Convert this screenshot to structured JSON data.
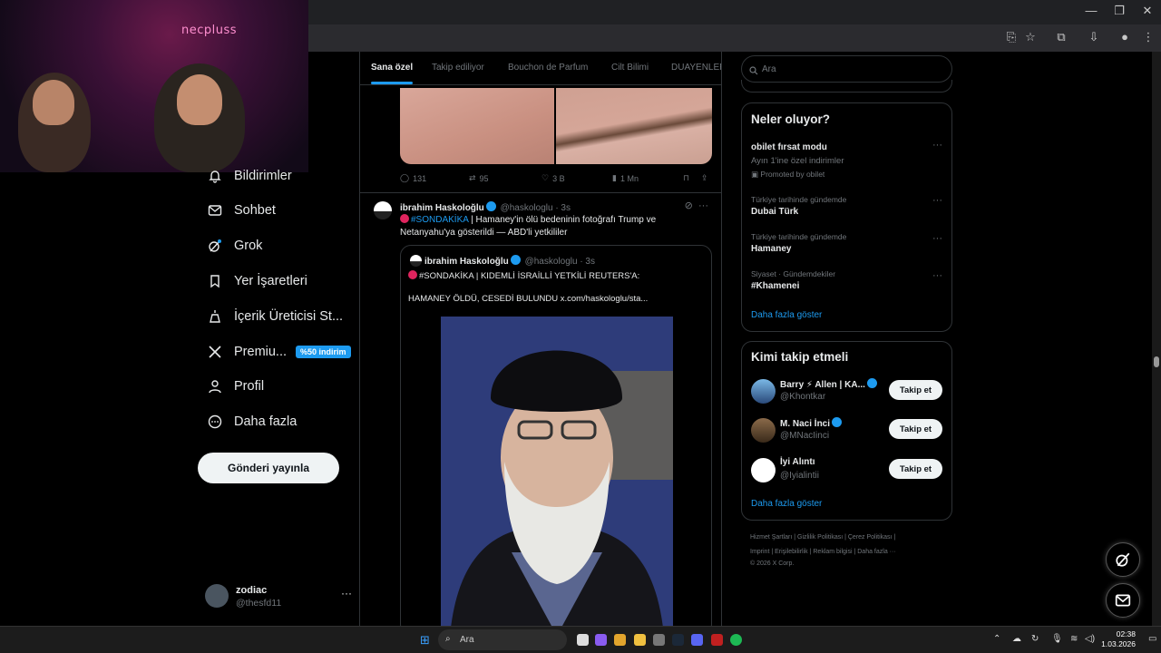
{
  "browser": {
    "minimize": "—",
    "restore": "❐",
    "close": "✕"
  },
  "webcam": {
    "brand": "necpluss"
  },
  "nav": {
    "items": [
      {
        "label": "Bildirimler",
        "icon": "bell-icon"
      },
      {
        "label": "Sohbet",
        "icon": "mail-icon"
      },
      {
        "label": "Grok",
        "icon": "grok-icon"
      },
      {
        "label": "Yer İşaretleri",
        "icon": "bookmark-icon"
      },
      {
        "label": "İçerik Üreticisi St...",
        "icon": "creator-icon"
      },
      {
        "label": "Premiu...",
        "icon": "x-logo-icon",
        "badge": "%50 indirim"
      },
      {
        "label": "Profil",
        "icon": "person-icon"
      },
      {
        "label": "Daha fazla",
        "icon": "more-circle-icon"
      }
    ],
    "post_button": "Gönderi yayınla",
    "account": {
      "name": "zodiac",
      "handle": "@thesfd11",
      "more": "···"
    }
  },
  "feed": {
    "tabs": [
      "Sana özel",
      "Takip ediliyor",
      "Bouchon de Parfum",
      "Cilt Bilimi",
      "DUAYENLER"
    ],
    "active_tab": "Sana özel",
    "prev_post_actions": {
      "replies": "131",
      "reposts": "95",
      "likes": "3 B",
      "views": "1 Mn"
    },
    "tweet": {
      "name": "ibrahim Haskoloğlu",
      "handle": "@haskologlu",
      "time": "· 3s",
      "hashtag": "#SONDAKİKA",
      "text": " | Hamaney'in ölü bedeninin fotoğrafı Trump ve Netanyahu'ya gösterildi — ABD'li yetkililer",
      "quote": {
        "name": "ibrahim Haskoloğlu",
        "handle": "@haskologlu",
        "time": "· 3s",
        "line1": "#SONDAKİKA | KIDEMLİ İSRAİLLİ YETKİLİ REUTERS'A:",
        "line2": "HAMANEY ÖLDÜ, CESEDİ BULUNDU  x.com/haskologlu/sta..."
      }
    }
  },
  "sidebar": {
    "search_placeholder": "Ara",
    "trends_title": "Neler oluyor?",
    "trends": [
      {
        "meta": "",
        "name": "obilet fırsat modu",
        "sub": "Ayın 1'ine özel indirimler",
        "promo": "Promoted by obilet"
      },
      {
        "meta": "Türkiye tarihinde gündemde",
        "name": "Dubai Türk"
      },
      {
        "meta": "Türkiye tarihinde gündemde",
        "name": "Hamaney"
      },
      {
        "meta": "Siyaset · Gündemdekiler",
        "name": "#Khamenei"
      }
    ],
    "trends_more": "Daha fazla göster",
    "who_title": "Kimi takip etmeli",
    "who": [
      {
        "name": "Barry ⚡ Allen | KA...",
        "handle": "@Khontkar",
        "button": "Takip et"
      },
      {
        "name": "M. Naci İnci",
        "handle": "@MNacIinci",
        "button": "Takip et"
      },
      {
        "name": "İyi Alıntı",
        "handle": "@Iyialintii",
        "button": "Takip et"
      }
    ],
    "who_more": "Daha fazla göster",
    "footer_line1": "Hizmet Şartları  |  Gizlilik Politikası  |  Çerez Politikası  |",
    "footer_line2": "Imprint  |  Erişilebilirlik  |  Reklam bilgisi  |  Daha fazla ···",
    "footer_line3": "© 2026 X Corp."
  },
  "taskbar": {
    "search": "Ara",
    "time": "02:38",
    "date": "1.03.2026"
  },
  "colors": {
    "accent": "#1d9bf0",
    "background": "#000000",
    "border": "#2f3336"
  }
}
